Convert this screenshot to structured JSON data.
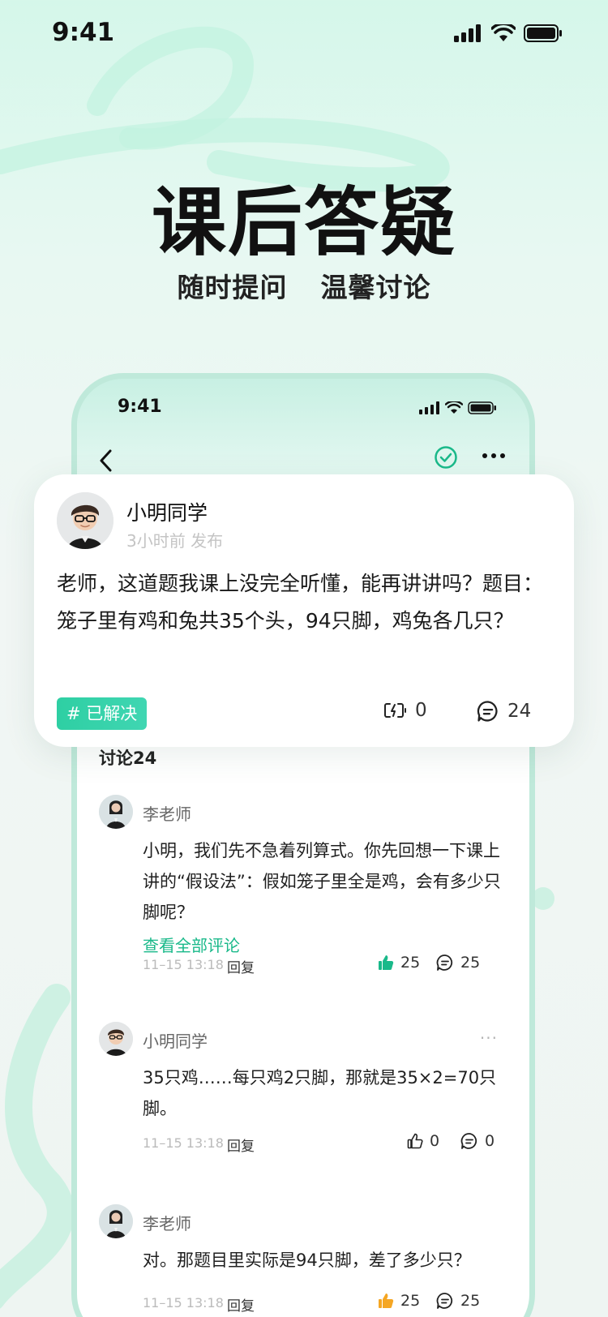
{
  "status_bar": {
    "time": "9:41"
  },
  "hero": {
    "title": "课后答疑",
    "subtitle": "随时提问  温馨讨论"
  },
  "phone": {
    "status_time": "9:41",
    "discussion_header": "讨论24",
    "comments": [
      {
        "author": "李老师",
        "text": "小明，我们先不急着列算式。你先回想一下课上讲的“假设法”：假如笼子里全是鸡，会有多少只脚呢？",
        "view_all": "查看全部评论",
        "time": "11–15 13:18",
        "reply": "回复",
        "likes": "25",
        "comments": "25"
      },
      {
        "author": "小明同学",
        "more": "···",
        "text": "35只鸡……每只鸡2只脚，那就是35×2=70只脚。",
        "time": "11–15 13:18",
        "reply": "回复",
        "likes": "0",
        "comments": "0"
      },
      {
        "author": "李老师",
        "text": "对。那题目里实际是94只脚，差了多少只？",
        "time": "11–15 13:18",
        "reply": "回复",
        "likes": "25",
        "comments": "25"
      }
    ]
  },
  "question_card": {
    "author": "小明同学",
    "time": "3小时前 发布",
    "text": "老师，这道题我课上没完全听懂，能再讲讲吗？题目：笼子里有鸡和兔共35个头，94只脚，鸡兔各几只？",
    "badge": "# 已解决",
    "likes": "0",
    "comments": "24"
  },
  "colors": {
    "accent": "#1ab98a",
    "badge": "#2ecfa3",
    "like_active": "#1ab98a",
    "like_orange": "#f5a623"
  }
}
